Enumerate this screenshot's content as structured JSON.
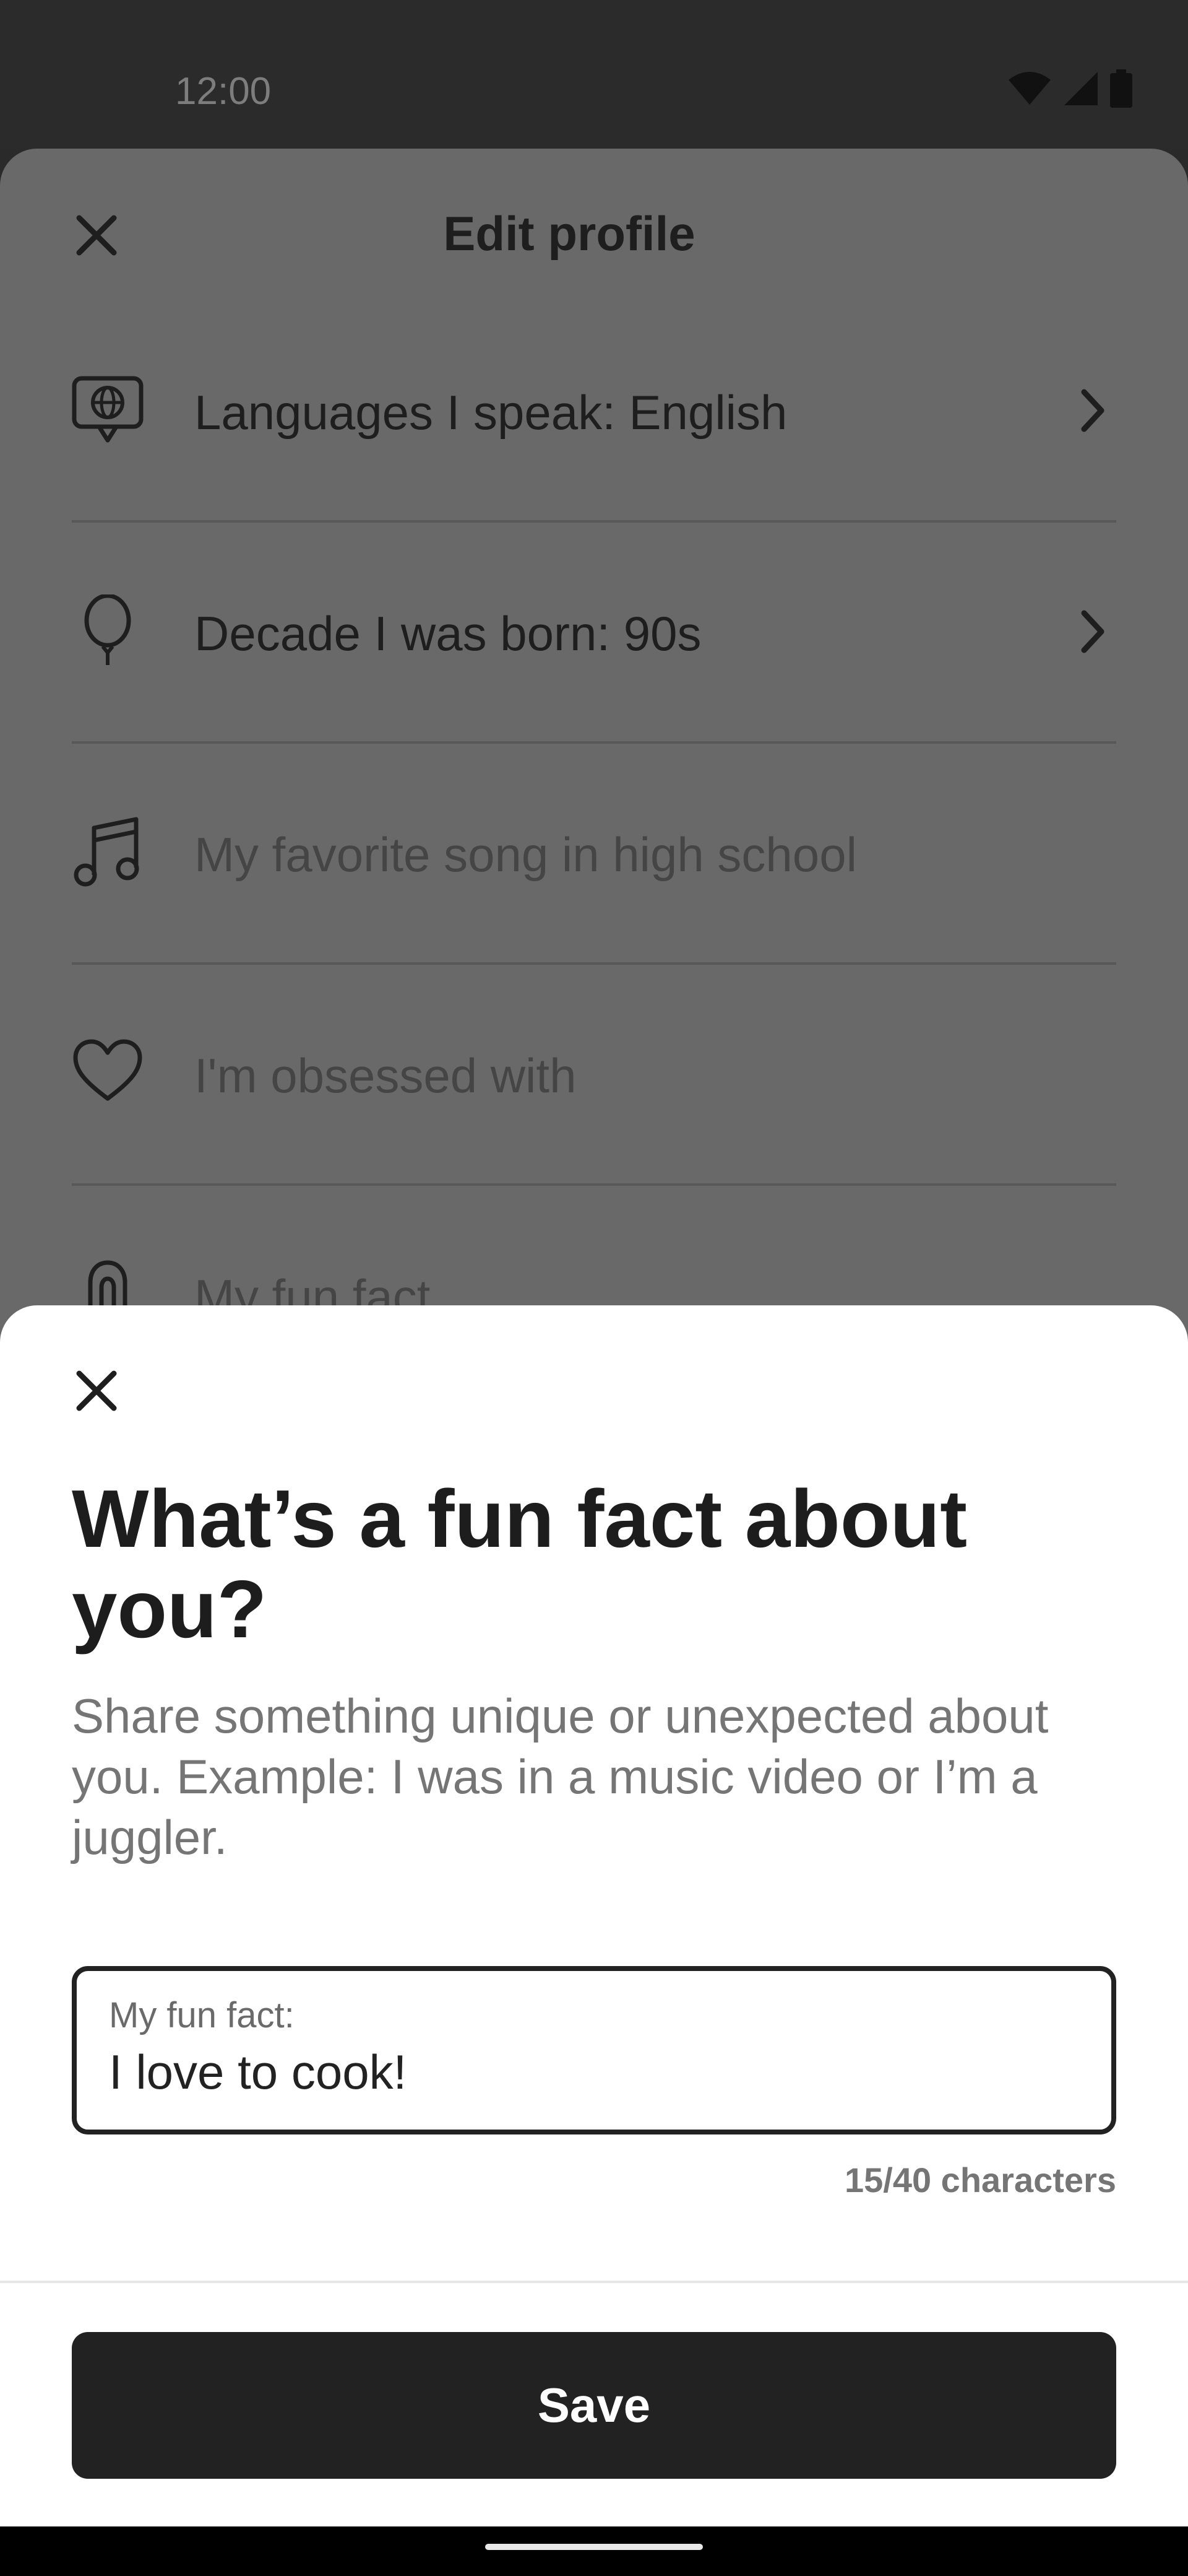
{
  "status_bar": {
    "time": "12:00"
  },
  "background_screen": {
    "title": "Edit profile",
    "items": [
      {
        "label": "Languages I speak: English",
        "icon": "language-speech-bubble-icon",
        "has_chevron": true
      },
      {
        "label": "Decade I was born: 90s",
        "icon": "balloon-icon",
        "has_chevron": true
      },
      {
        "label": "My favorite song in high school",
        "icon": "music-note-icon",
        "has_chevron": false
      },
      {
        "label": "I'm obsessed with",
        "icon": "heart-icon",
        "has_chevron": false
      },
      {
        "label": "My fun fact",
        "icon": "pin-icon",
        "has_chevron": false
      }
    ]
  },
  "sheet": {
    "title": "What’s a fun fact about you?",
    "description": "Share something unique or unexpected about you. Example: I was in a music video or I’m a juggler.",
    "input": {
      "label": "My fun fact:",
      "value": "I love to cook!"
    },
    "char_count": "15/40 characters",
    "save_label": "Save"
  },
  "colors": {
    "accent": "#222222",
    "background_dim": "#696969",
    "muted_text": "#757575"
  }
}
